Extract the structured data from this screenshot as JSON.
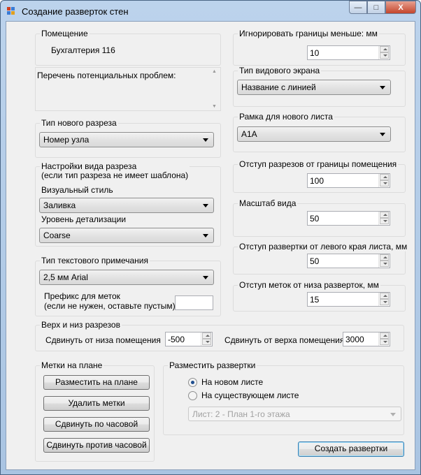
{
  "window": {
    "title": "Создание разверток стен",
    "minimize": "—",
    "maximize": "□",
    "close": "X"
  },
  "room": {
    "label": "Помещение",
    "value": "Бухгалтерия 116"
  },
  "problems": {
    "text": "Перечень потенциальных проблем:"
  },
  "section_type": {
    "label": "Тип нового разреза",
    "value": "Номер узла"
  },
  "view_settings": {
    "label1": "Настройки вида разреза",
    "label2": "(если тип разреза не имеет шаблона)",
    "visual_style_label": "Визуальный стиль",
    "visual_style_value": "Заливка",
    "detail_label": "Уровень детализации",
    "detail_value": "Coarse"
  },
  "text_note": {
    "label": "Тип текстового примечания",
    "value": "2,5 мм Arial",
    "prefix_label1": "Префикс для меток",
    "prefix_label2": "(если не нужен, оставьте пустым)",
    "prefix_value": ""
  },
  "top_bottom": {
    "label": "Верх и низ разрезов",
    "bottom_label": "Сдвинуть от низа помещения",
    "bottom_value": "-500",
    "top_label": "Сдвинуть от верха помещения",
    "top_value": "3000"
  },
  "marks": {
    "label": "Метки на плане",
    "buttons": [
      "Разместить на плане",
      "Удалить метки",
      "Сдвинуть по часовой",
      "Сдвинуть против часовой"
    ]
  },
  "placement": {
    "label": "Разместить развертки",
    "options": [
      "На новом листе",
      "На существующем листе"
    ],
    "selected": 0,
    "sheet_value": "Лист: 2 - План 1-го этажа"
  },
  "create_button": "Создать развертки",
  "ignore": {
    "label": "Игнорировать границы меньше: мм",
    "value": "10"
  },
  "viewport": {
    "label": "Тип видового экрана",
    "value": "Название с линией"
  },
  "titleblock": {
    "label": "Рамка для нового листа",
    "value": "A1A"
  },
  "offset_room": {
    "label": "Отступ разрезов от границы помещения",
    "value": "100"
  },
  "scale": {
    "label": "Масштаб вида",
    "value": "50"
  },
  "offset_left": {
    "label": "Отступ развертки от левого края листа, мм",
    "value": "50"
  },
  "offset_marks": {
    "label": "Отступ меток от низа разверток, мм",
    "value": "15"
  }
}
